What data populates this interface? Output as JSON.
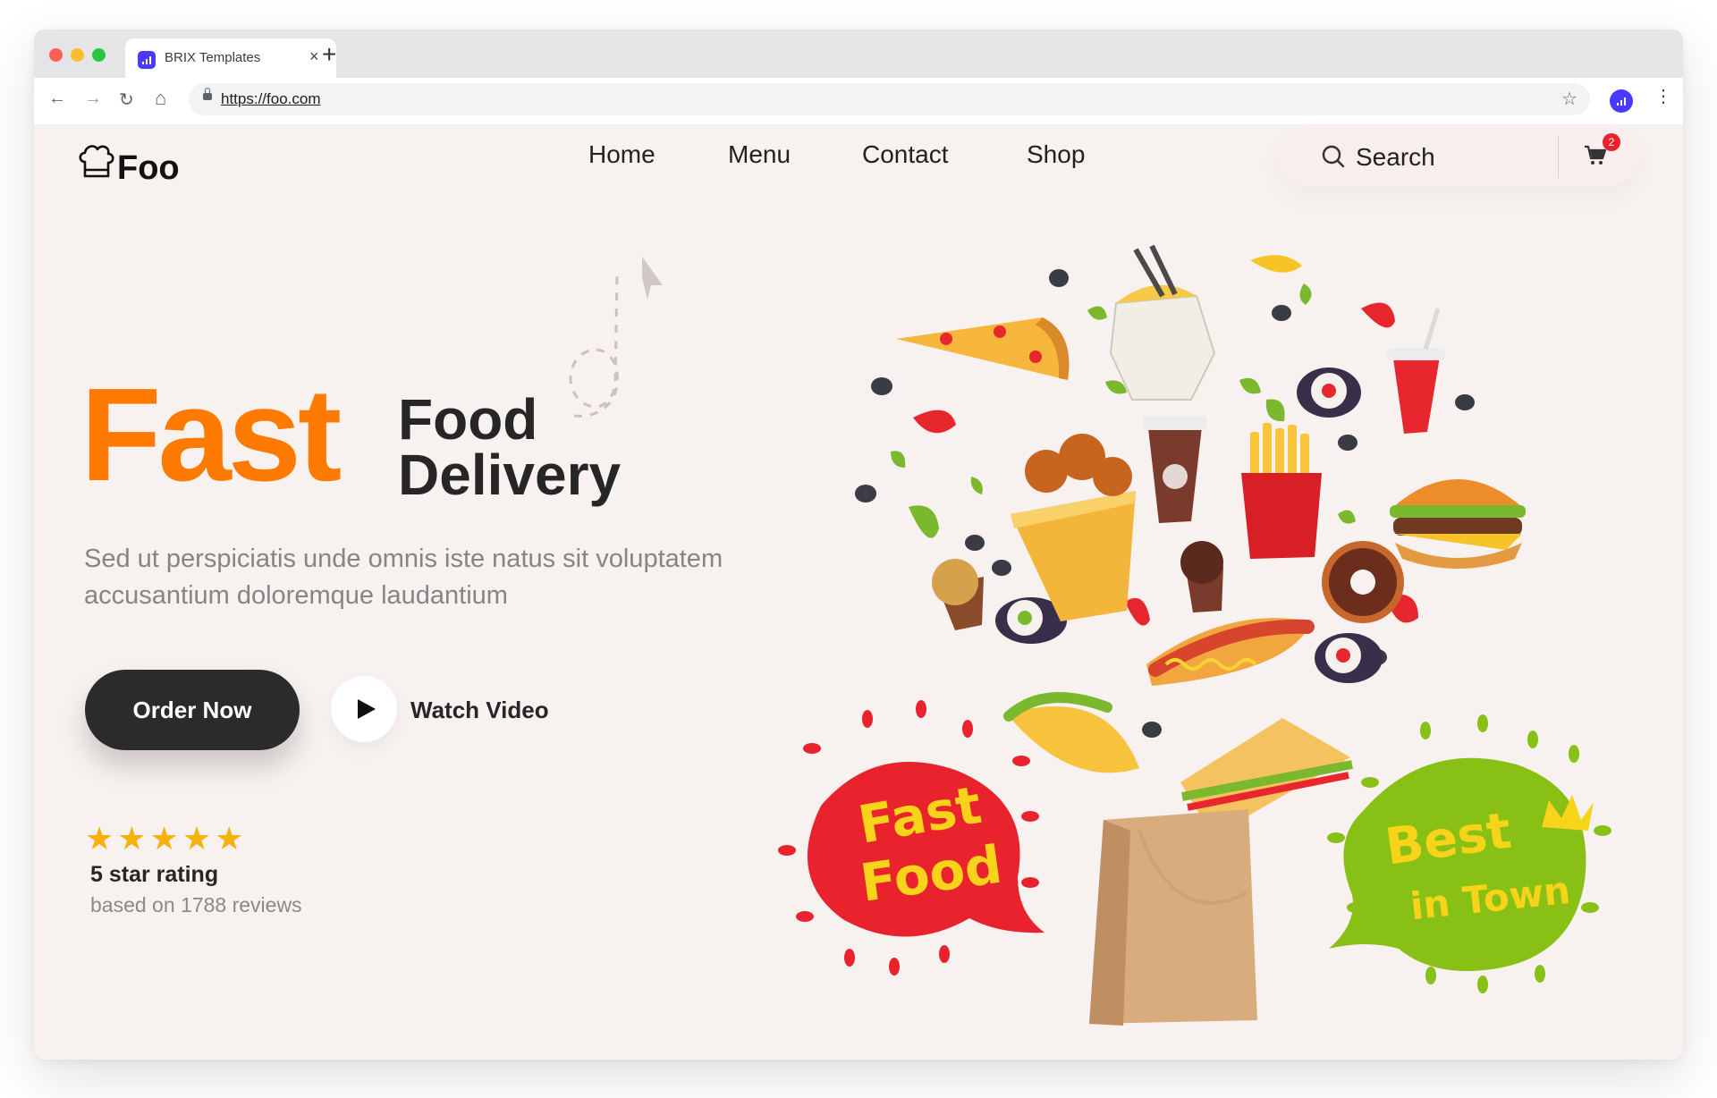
{
  "browser": {
    "tab_title": "BRIX Templates",
    "tab_close": "×",
    "new_tab": "+",
    "url": "https://foo.com",
    "back": "←",
    "forward": "→",
    "reload": "↻",
    "home": "⌂",
    "bookmark": "☆",
    "menu": "⋮"
  },
  "header": {
    "logo_text": "Foo",
    "nav": [
      "Home",
      "Menu",
      "Contact",
      "Shop"
    ],
    "search_label": "Search",
    "cart_count": "2"
  },
  "hero": {
    "word_fast": "Fast",
    "word_food": "Food",
    "word_delivery": "Delivery",
    "subtitle": "Sed ut perspiciatis unde omnis iste natus sit voluptatem accusantium doloremque laudantium",
    "order_button": "Order Now",
    "watch_video": "Watch Video",
    "stars": "★★★★★",
    "rating_label": "5 star rating",
    "reviews_label": "based on 1788 reviews",
    "badge_left_line1": "Fast",
    "badge_left_line2": "Food",
    "badge_right_line1": "Best",
    "badge_right_line2": "in Town"
  },
  "colors": {
    "accent": "#ff7a00",
    "dark": "#2b2b2b",
    "background": "#f7f1f0",
    "brand": "#4a3aff",
    "badge_red": "#e8232d",
    "badge_green": "#88c016",
    "star": "#f5b10d"
  },
  "icons": [
    "brix-favicon-icon",
    "back-arrow-icon",
    "forward-arrow-icon",
    "reload-icon",
    "home-icon",
    "lock-icon",
    "bookmark-star-icon",
    "profile-icon",
    "kebab-menu-icon",
    "chef-hat-icon",
    "search-icon",
    "cart-icon",
    "play-icon",
    "star-icon"
  ]
}
